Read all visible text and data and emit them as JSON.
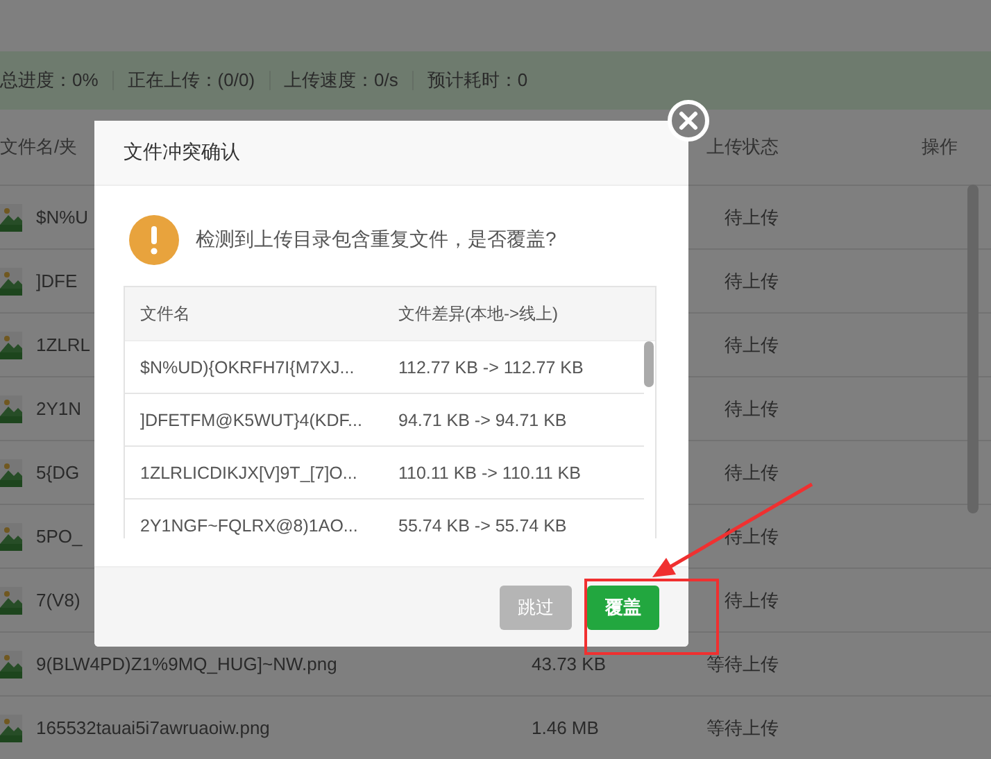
{
  "stats": [
    "总进度：0%",
    "正在上传：(0/0)",
    "上传速度：0/s",
    "预计耗时：0"
  ],
  "file_table": {
    "columns": [
      "文件名/夹",
      "上传状态",
      "操作"
    ],
    "rows": [
      {
        "name": "$N%U",
        "size": "",
        "status": "待上传"
      },
      {
        "name": "]DFE",
        "size": "",
        "status": "待上传"
      },
      {
        "name": "1ZLRL",
        "size": "",
        "status": "待上传"
      },
      {
        "name": "2Y1N",
        "size": "",
        "status": "待上传"
      },
      {
        "name": "5{DG",
        "size": "",
        "status": "待上传"
      },
      {
        "name": "5PO_",
        "size": "",
        "status": "待上传"
      },
      {
        "name": "7(V8)",
        "size": "",
        "status": "待上传"
      },
      {
        "name": "9(BLW4PD)Z1%9MQ_HUG]~NW.png",
        "size": "43.73 KB",
        "status": "等待上传"
      },
      {
        "name": "165532tauai5i7awruaoiw.png",
        "size": "1.46 MB",
        "status": "等待上传"
      }
    ]
  },
  "dialog": {
    "title": "文件冲突确认",
    "message": "检测到上传目录包含重复文件，是否覆盖?",
    "columns": [
      "文件名",
      "文件差异(本地->线上)"
    ],
    "rows": [
      {
        "name": "$N%UD){OKRFH7I{M7XJ...",
        "diff": "112.77 KB -> 112.77 KB"
      },
      {
        "name": "]DFETFM@K5WUT}4(KDF...",
        "diff": "94.71 KB -> 94.71 KB"
      },
      {
        "name": "1ZLRLICDIKJX[V]9T_[7]O...",
        "diff": "110.11 KB -> 110.11 KB"
      },
      {
        "name": "2Y1NGF~FQLRX@8)1AO...",
        "diff": "55.74 KB -> 55.74 KB"
      }
    ],
    "buttons": [
      {
        "label": "跳过",
        "kind": "secondary",
        "disabled": true
      },
      {
        "label": "覆盖",
        "kind": "primary",
        "disabled": false
      }
    ]
  }
}
